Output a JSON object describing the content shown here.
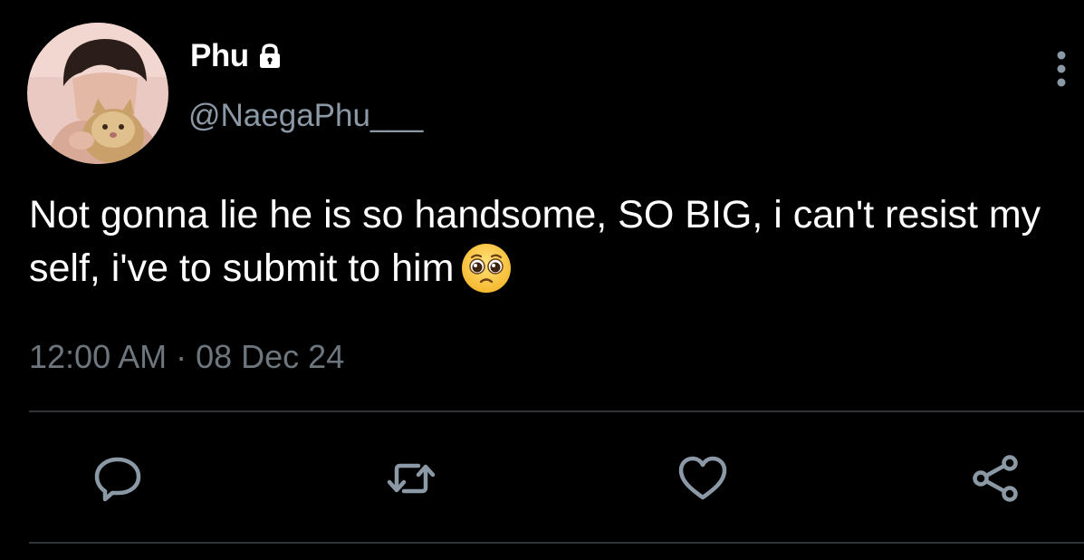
{
  "tweet": {
    "author": {
      "display_name": "Phu",
      "handle": "@NaegaPhu___",
      "protected_icon": "lock-icon",
      "avatar": "avatar-photo"
    },
    "text": "Not gonna lie he is so handsome, SO BIG, i can't resist my self, i've to submit to him",
    "emoji": "pleading-face-emoji",
    "time": "12:00 AM",
    "separator": " · ",
    "date": "08 Dec 24"
  },
  "actions": [
    {
      "icon": "reply-icon"
    },
    {
      "icon": "retweet-icon"
    },
    {
      "icon": "like-icon"
    },
    {
      "icon": "share-icon"
    }
  ],
  "menu": {
    "icon": "more-vertical-icon"
  },
  "colors": {
    "background": "#000000",
    "primary_text": "#ffffff",
    "secondary_text": "#8b98a5",
    "icon": "#8b98a5",
    "divider": "#2f3336"
  }
}
